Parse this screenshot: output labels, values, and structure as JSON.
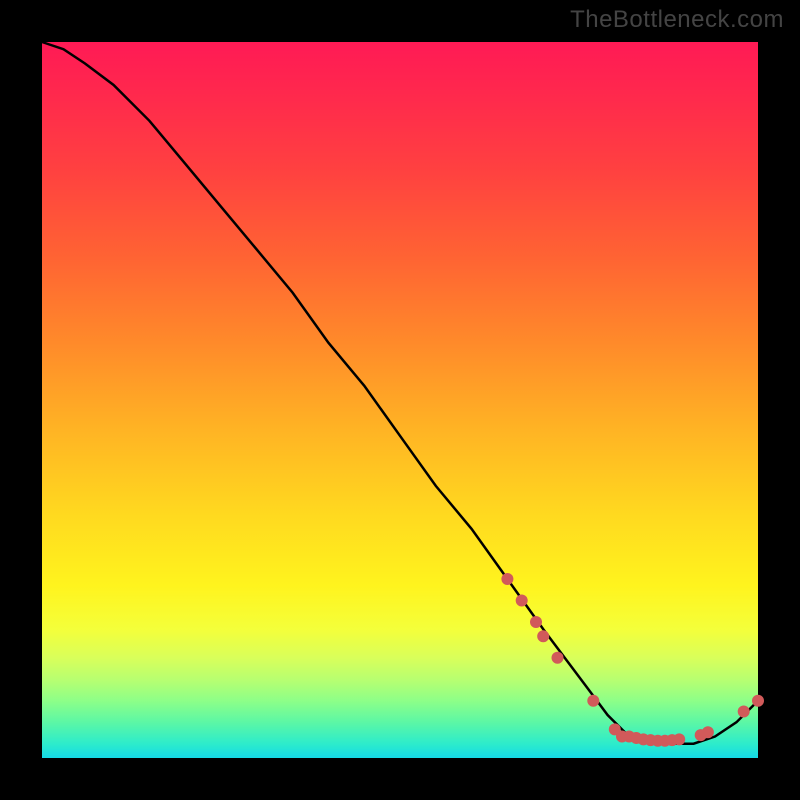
{
  "watermark": "TheBottleneck.com",
  "chart_data": {
    "type": "line",
    "title": "",
    "xlabel": "",
    "ylabel": "",
    "xlim": [
      0,
      100
    ],
    "ylim": [
      0,
      100
    ],
    "series": [
      {
        "name": "curve",
        "x": [
          0,
          3,
          6,
          10,
          15,
          20,
          25,
          30,
          35,
          40,
          45,
          50,
          55,
          60,
          65,
          70,
          73,
          76,
          79,
          82,
          85,
          88,
          91,
          94,
          97,
          100
        ],
        "y": [
          100,
          99,
          97,
          94,
          89,
          83,
          77,
          71,
          65,
          58,
          52,
          45,
          38,
          32,
          25,
          18,
          14,
          10,
          6,
          3,
          2,
          2,
          2,
          3,
          5,
          8
        ]
      }
    ],
    "markers": [
      {
        "x": 65,
        "y": 25
      },
      {
        "x": 67,
        "y": 22
      },
      {
        "x": 69,
        "y": 19
      },
      {
        "x": 70,
        "y": 17
      },
      {
        "x": 72,
        "y": 14
      },
      {
        "x": 77,
        "y": 8
      },
      {
        "x": 80,
        "y": 4
      },
      {
        "x": 81,
        "y": 3
      },
      {
        "x": 82,
        "y": 3
      },
      {
        "x": 83,
        "y": 2.8
      },
      {
        "x": 84,
        "y": 2.6
      },
      {
        "x": 85,
        "y": 2.5
      },
      {
        "x": 86,
        "y": 2.4
      },
      {
        "x": 87,
        "y": 2.4
      },
      {
        "x": 88,
        "y": 2.5
      },
      {
        "x": 89,
        "y": 2.6
      },
      {
        "x": 92,
        "y": 3.2
      },
      {
        "x": 93,
        "y": 3.6
      },
      {
        "x": 98,
        "y": 6.5
      },
      {
        "x": 100,
        "y": 8
      }
    ],
    "marker_color": "#d15a5a",
    "curve_color": "#000000",
    "gradient_stops": [
      {
        "pos": 0,
        "color": "#ff1a55"
      },
      {
        "pos": 50,
        "color": "#ffb324"
      },
      {
        "pos": 80,
        "color": "#fff41e"
      },
      {
        "pos": 100,
        "color": "#15d9e6"
      }
    ]
  }
}
